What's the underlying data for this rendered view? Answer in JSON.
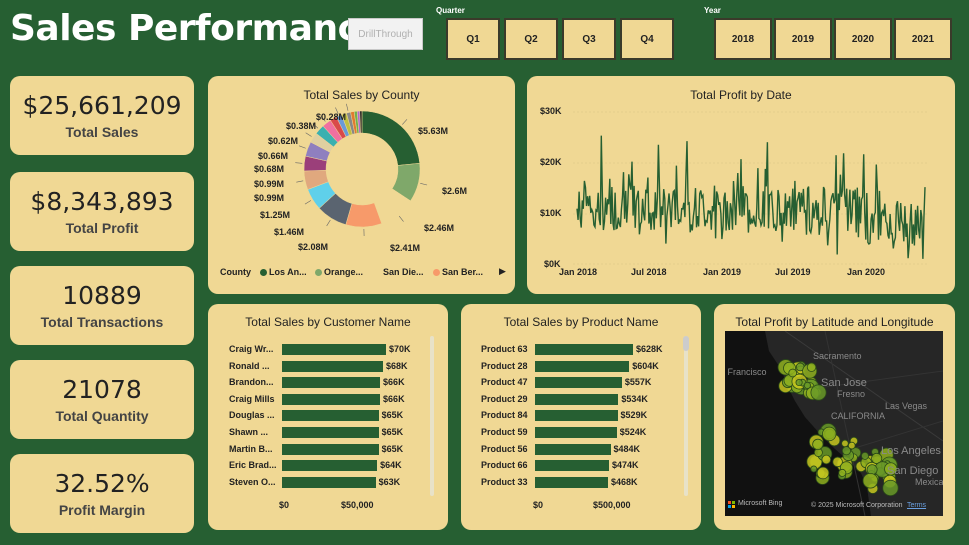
{
  "header": {
    "title": "Sales Performance",
    "drill_label": "DrillThrough",
    "quarter_label": "Quarter",
    "year_label": "Year",
    "quarters": [
      "Q1",
      "Q2",
      "Q3",
      "Q4"
    ],
    "years": [
      "2018",
      "2019",
      "2020",
      "2021"
    ]
  },
  "kpis": [
    {
      "value": "$25,661,209",
      "label": "Total Sales"
    },
    {
      "value": "$8,343,893",
      "label": "Total Profit"
    },
    {
      "value": "10889",
      "label": "Total Transactions"
    },
    {
      "value": "21078",
      "label": "Total Quantity"
    },
    {
      "value": "32.52%",
      "label": "Profit Margin"
    }
  ],
  "donut": {
    "title": "Total Sales by County",
    "legend_title": "County",
    "legend_items": [
      {
        "name": "Los An...",
        "color": "#265f32"
      },
      {
        "name": "Orange...",
        "color": "#7fa86a"
      },
      {
        "name": "San Die...",
        "color": "#f0d894"
      },
      {
        "name": "San Ber...",
        "color": "#f79a6a"
      }
    ],
    "more_arrow": "▶",
    "slices": [
      {
        "label": "$5.63M",
        "value": 5.63,
        "color": "#265f32"
      },
      {
        "label": "$2.6M",
        "value": 2.6,
        "color": "#7fa86a"
      },
      {
        "label": "$2.46M",
        "value": 2.46,
        "color": "#f0d894"
      },
      {
        "label": "$2.41M",
        "value": 2.41,
        "color": "#f79a6a"
      },
      {
        "label": "$2.08M",
        "value": 2.08,
        "color": "#5a6470"
      },
      {
        "label": "$1.46M",
        "value": 1.46,
        "color": "#5fd0ea"
      },
      {
        "label": "$1.25M",
        "value": 1.25,
        "color": "#e0a87e"
      },
      {
        "label": "$0.99M",
        "value": 0.99,
        "color": "#9b3f7a"
      },
      {
        "label": "$0.99M",
        "value": 0.99,
        "color": "#8f7fbf"
      },
      {
        "label": "$0.68M",
        "value": 0.68,
        "color": "#e0d0a0"
      },
      {
        "label": "$0.66M",
        "value": 0.66,
        "color": "#3ab0b0"
      },
      {
        "label": "$0.62M",
        "value": 0.62,
        "color": "#f070a0"
      },
      {
        "label": "",
        "value": 0.45,
        "color": "#d94a4a"
      },
      {
        "label": "$0.38M",
        "value": 0.38,
        "color": "#6a9ad8"
      },
      {
        "label": "",
        "value": 0.33,
        "color": "#c0c040"
      },
      {
        "label": "$0.28M",
        "value": 0.28,
        "color": "#888888"
      },
      {
        "label": "",
        "value": 0.24,
        "color": "#e07a30"
      },
      {
        "label": "",
        "value": 0.2,
        "color": "#70b050"
      },
      {
        "label": "",
        "value": 0.17,
        "color": "#b06ad0"
      },
      {
        "label": "",
        "value": 0.15,
        "color": "#2a2a2a"
      }
    ]
  },
  "line": {
    "title": "Total Profit by Date",
    "y_ticks": [
      "$30K",
      "$20K",
      "$10K",
      "$0K"
    ],
    "x_ticks": [
      "Jan 2018",
      "Jul 2018",
      "Jan 2019",
      "Jul 2019",
      "Jan 2020"
    ]
  },
  "customers": {
    "title": "Total Sales by Customer Name",
    "axis": [
      "$0",
      "$50,000"
    ],
    "rows": [
      {
        "name": "Craig Wr...",
        "label": "$70K",
        "value": 70
      },
      {
        "name": "Ronald ...",
        "label": "$68K",
        "value": 68
      },
      {
        "name": "Brandon...",
        "label": "$66K",
        "value": 66
      },
      {
        "name": "Craig Mills",
        "label": "$66K",
        "value": 66
      },
      {
        "name": "Douglas ...",
        "label": "$65K",
        "value": 65
      },
      {
        "name": "Shawn ...",
        "label": "$65K",
        "value": 65
      },
      {
        "name": "Martin B...",
        "label": "$65K",
        "value": 65
      },
      {
        "name": "Eric Brad...",
        "label": "$64K",
        "value": 64
      },
      {
        "name": "Steven O...",
        "label": "$63K",
        "value": 63
      }
    ]
  },
  "products": {
    "title": "Total Sales by Product Name",
    "axis": [
      "$0",
      "$500,000"
    ],
    "rows": [
      {
        "name": "Product 63",
        "label": "$628K",
        "value": 628
      },
      {
        "name": "Product 28",
        "label": "$604K",
        "value": 604
      },
      {
        "name": "Product 47",
        "label": "$557K",
        "value": 557
      },
      {
        "name": "Product 29",
        "label": "$534K",
        "value": 534
      },
      {
        "name": "Product 84",
        "label": "$529K",
        "value": 529
      },
      {
        "name": "Product 59",
        "label": "$524K",
        "value": 524
      },
      {
        "name": "Product 56",
        "label": "$484K",
        "value": 484
      },
      {
        "name": "Product 66",
        "label": "$474K",
        "value": 474
      },
      {
        "name": "Product 33",
        "label": "$468K",
        "value": 468
      }
    ]
  },
  "map": {
    "title": "Total Profit by Latitude and Longitude",
    "place_labels": [
      "San Francisco",
      "Sacramento",
      "San Jose",
      "Fresno",
      "CALIFORNIA",
      "Las Vegas",
      "Los Angeles",
      "San Diego",
      "Mexicali"
    ],
    "bing": "Microsoft Bing",
    "copyright": "© 2025 Microsoft Corporation",
    "terms": "Terms"
  }
}
